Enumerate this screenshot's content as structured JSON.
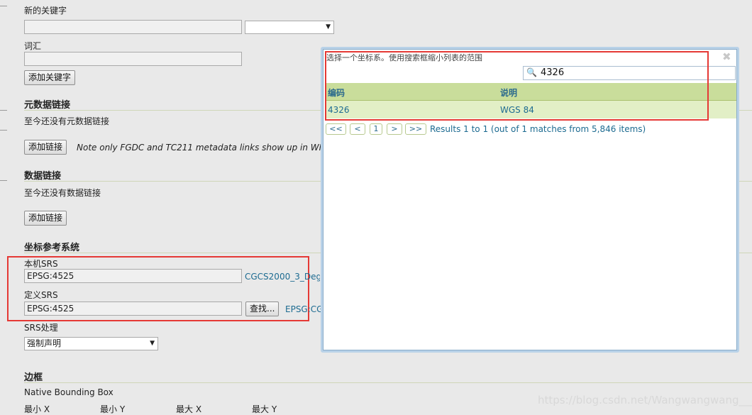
{
  "keywords": {
    "new_keyword_label": "新的关键字",
    "vocabulary_label": "词汇",
    "add_keyword_button": "添加关键字"
  },
  "metadata_links": {
    "heading": "元数据链接",
    "empty_text": "至今还没有元数据链接",
    "add_button": "添加链接",
    "note": "Note only FGDC and TC211 metadata links show up in WMS 1.1..."
  },
  "data_links": {
    "heading": "数据链接",
    "empty_text": "至今还没有数据链接",
    "add_button": "添加链接"
  },
  "crs": {
    "heading": "坐标参考系统",
    "native_label": "本机SRS",
    "native_value": "EPSG:4525",
    "native_link": "CGCS2000_3_Degre",
    "declared_label": "定义SRS",
    "declared_value": "EPSG:4525",
    "find_button": "查找...",
    "declared_link": "EPSG:CGC",
    "handling_label": "SRS处理",
    "handling_value": "强制声明"
  },
  "bbox": {
    "heading": "边框",
    "native_label": "Native Bounding Box",
    "min_x": "最小 X",
    "min_y": "最小 Y",
    "max_x": "最大 X",
    "max_y": "最大 Y"
  },
  "dialog": {
    "title": "选择一个坐标系。使用搜索框缩小列表的范围",
    "close_icon": "close-icon",
    "search_value": "4326",
    "search_icon": "search-icon",
    "columns": [
      "编码",
      "说明"
    ],
    "rows": [
      {
        "code": "4326",
        "description": "WGS 84"
      }
    ],
    "pager": {
      "first": "<<",
      "prev": "<",
      "page": "1",
      "next": ">",
      "last": ">>",
      "summary": "Results 1 to 1 (out of 1 matches from 5,846 items)"
    }
  },
  "watermark": "https://blog.csdn.net/Wangwangwang___",
  "colors": {
    "highlight": "#e53935",
    "link": "#1d6b91",
    "table_header": "#c9dd9b",
    "table_row": "#e2efc6"
  }
}
